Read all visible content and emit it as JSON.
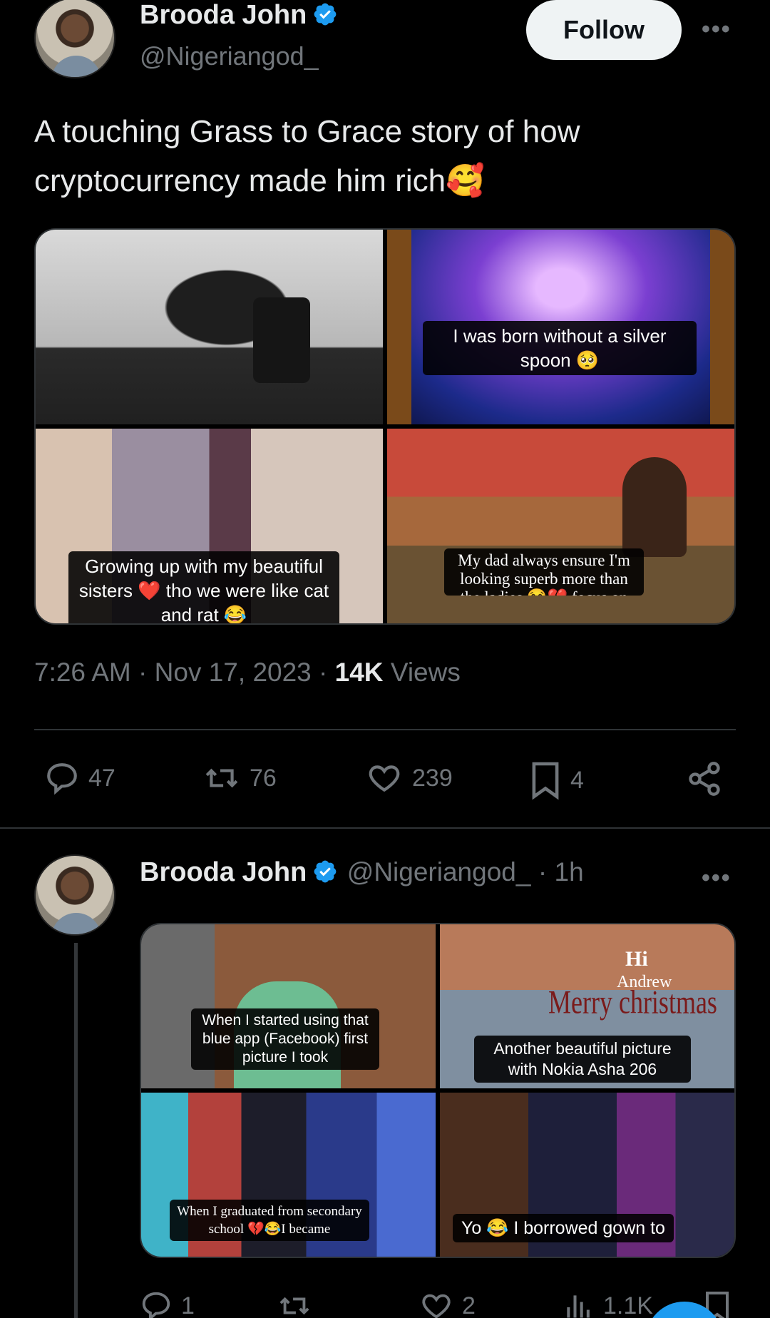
{
  "tweet": {
    "author_name": "Brooda John",
    "author_handle": "@Nigeriangod_",
    "follow_label": "Follow",
    "more_label": "•••",
    "text": "A touching Grass to Grace story of how cryptocurrency made him rich🥰",
    "media": [
      {
        "caption": ""
      },
      {
        "caption": "I was born without a silver spoon 🥺"
      },
      {
        "caption": "Growing up with my beautiful sisters ❤️ tho we were like cat and rat 😂"
      },
      {
        "caption": "My dad always ensure I'm looking superb more than the ladies 😂💔,focus on my shoe na"
      }
    ],
    "time": "7:26 AM",
    "separator": "·",
    "date": "Nov 17, 2023",
    "views_count": "14K",
    "views_label": "Views",
    "actions": {
      "replies": "47",
      "reposts": "76",
      "likes": "239",
      "bookmarks": "4"
    }
  },
  "reply": {
    "author_name": "Brooda John",
    "author_handle": "@Nigeriangod_",
    "time_ago": "· 1h",
    "more_label": "•••",
    "media": [
      {
        "caption": "When I started using that blue app (Facebook) first picture I took"
      },
      {
        "caption": "Another beautiful picture with Nokia Asha 206",
        "overlay_hi": "Hi",
        "overlay_andrew": "Andrew",
        "overlay_merry": "Merry christmas"
      },
      {
        "caption": "When I graduated from secondary school 💔😂I became"
      },
      {
        "caption": "Yo 😂 I borrowed gown to"
      }
    ],
    "actions": {
      "replies": "1",
      "reposts": "",
      "likes": "2",
      "views": "1.1K"
    }
  },
  "colors": {
    "background": "#000000",
    "text_primary": "#e7e9ea",
    "text_secondary": "#71767b",
    "verified_blue": "#1d9bf0",
    "divider": "#2f3336"
  },
  "icons": [
    "verified-badge-icon",
    "more-icon",
    "reply-icon",
    "repost-icon",
    "like-icon",
    "bookmark-icon",
    "share-icon",
    "views-icon"
  ]
}
